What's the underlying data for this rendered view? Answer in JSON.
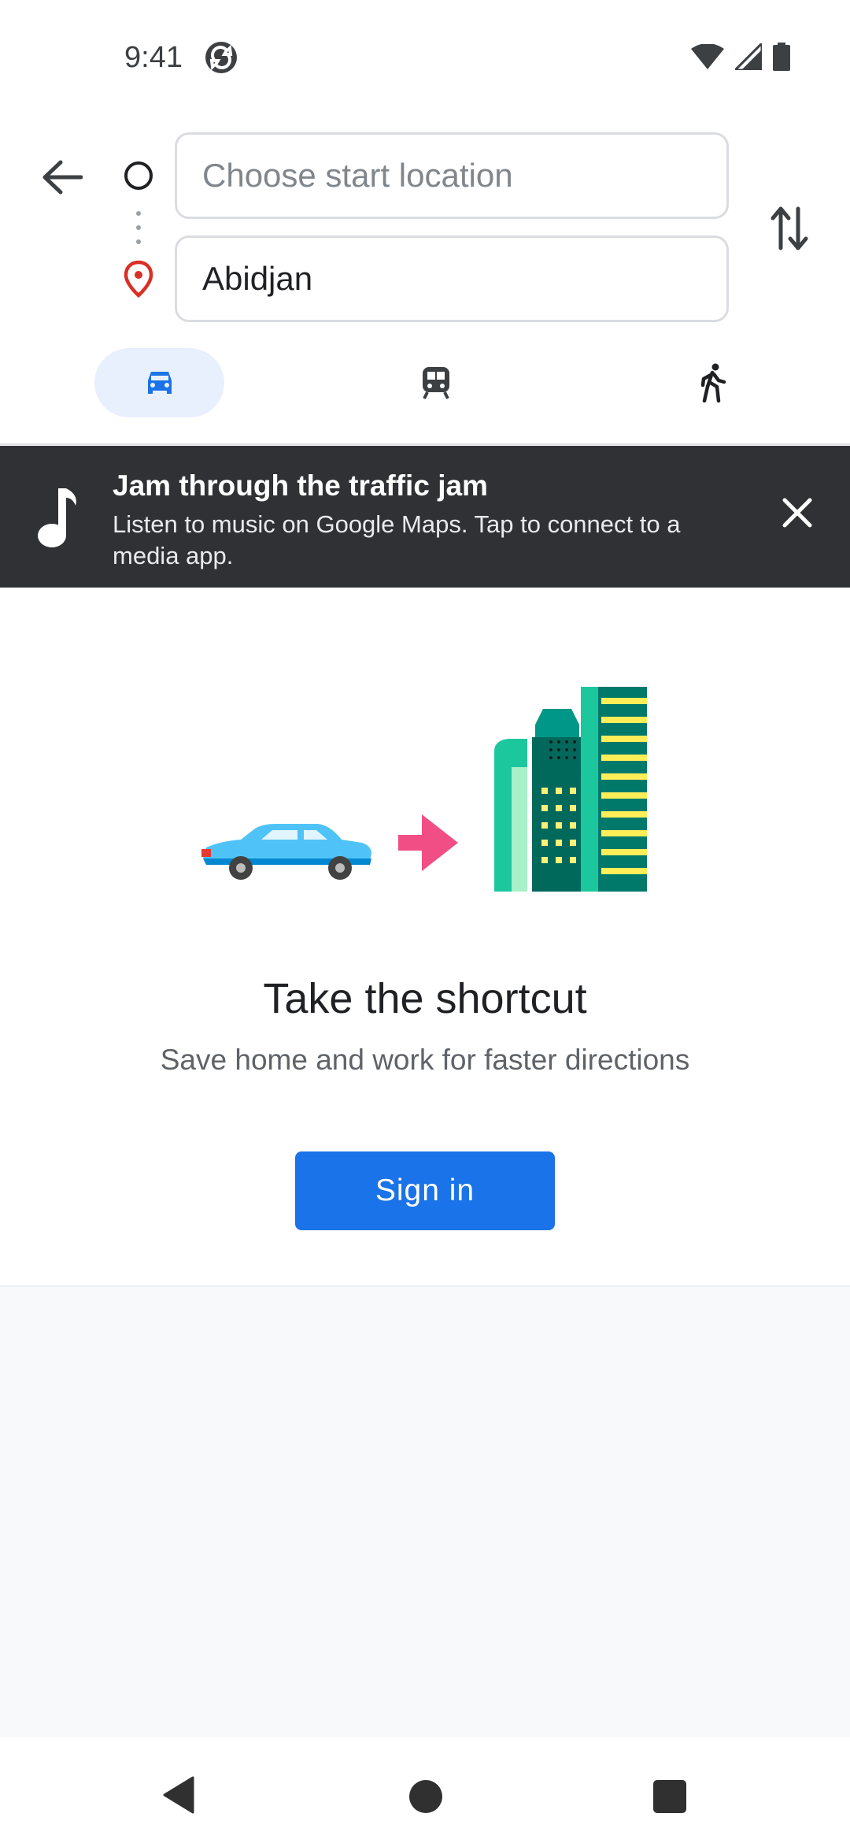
{
  "status_bar": {
    "time": "9:41"
  },
  "directions": {
    "start_placeholder": "Choose start location",
    "destination_value": "Abidjan",
    "modes": [
      {
        "icon": "car-icon",
        "selected": true
      },
      {
        "icon": "train-icon",
        "selected": false
      },
      {
        "icon": "walk-icon",
        "selected": false
      }
    ]
  },
  "banner": {
    "title": "Jam through the traffic jam",
    "body": "Listen to music on Google Maps. Tap to connect to a media app."
  },
  "promo": {
    "title": "Take the shortcut",
    "subtitle": "Save home and work for faster directions",
    "button_label": "Sign in"
  },
  "colors": {
    "accent": "#1a73e8",
    "selected_mode_bg": "#e8f0fe",
    "banner_bg": "#303134",
    "pin_red": "#d93025"
  }
}
